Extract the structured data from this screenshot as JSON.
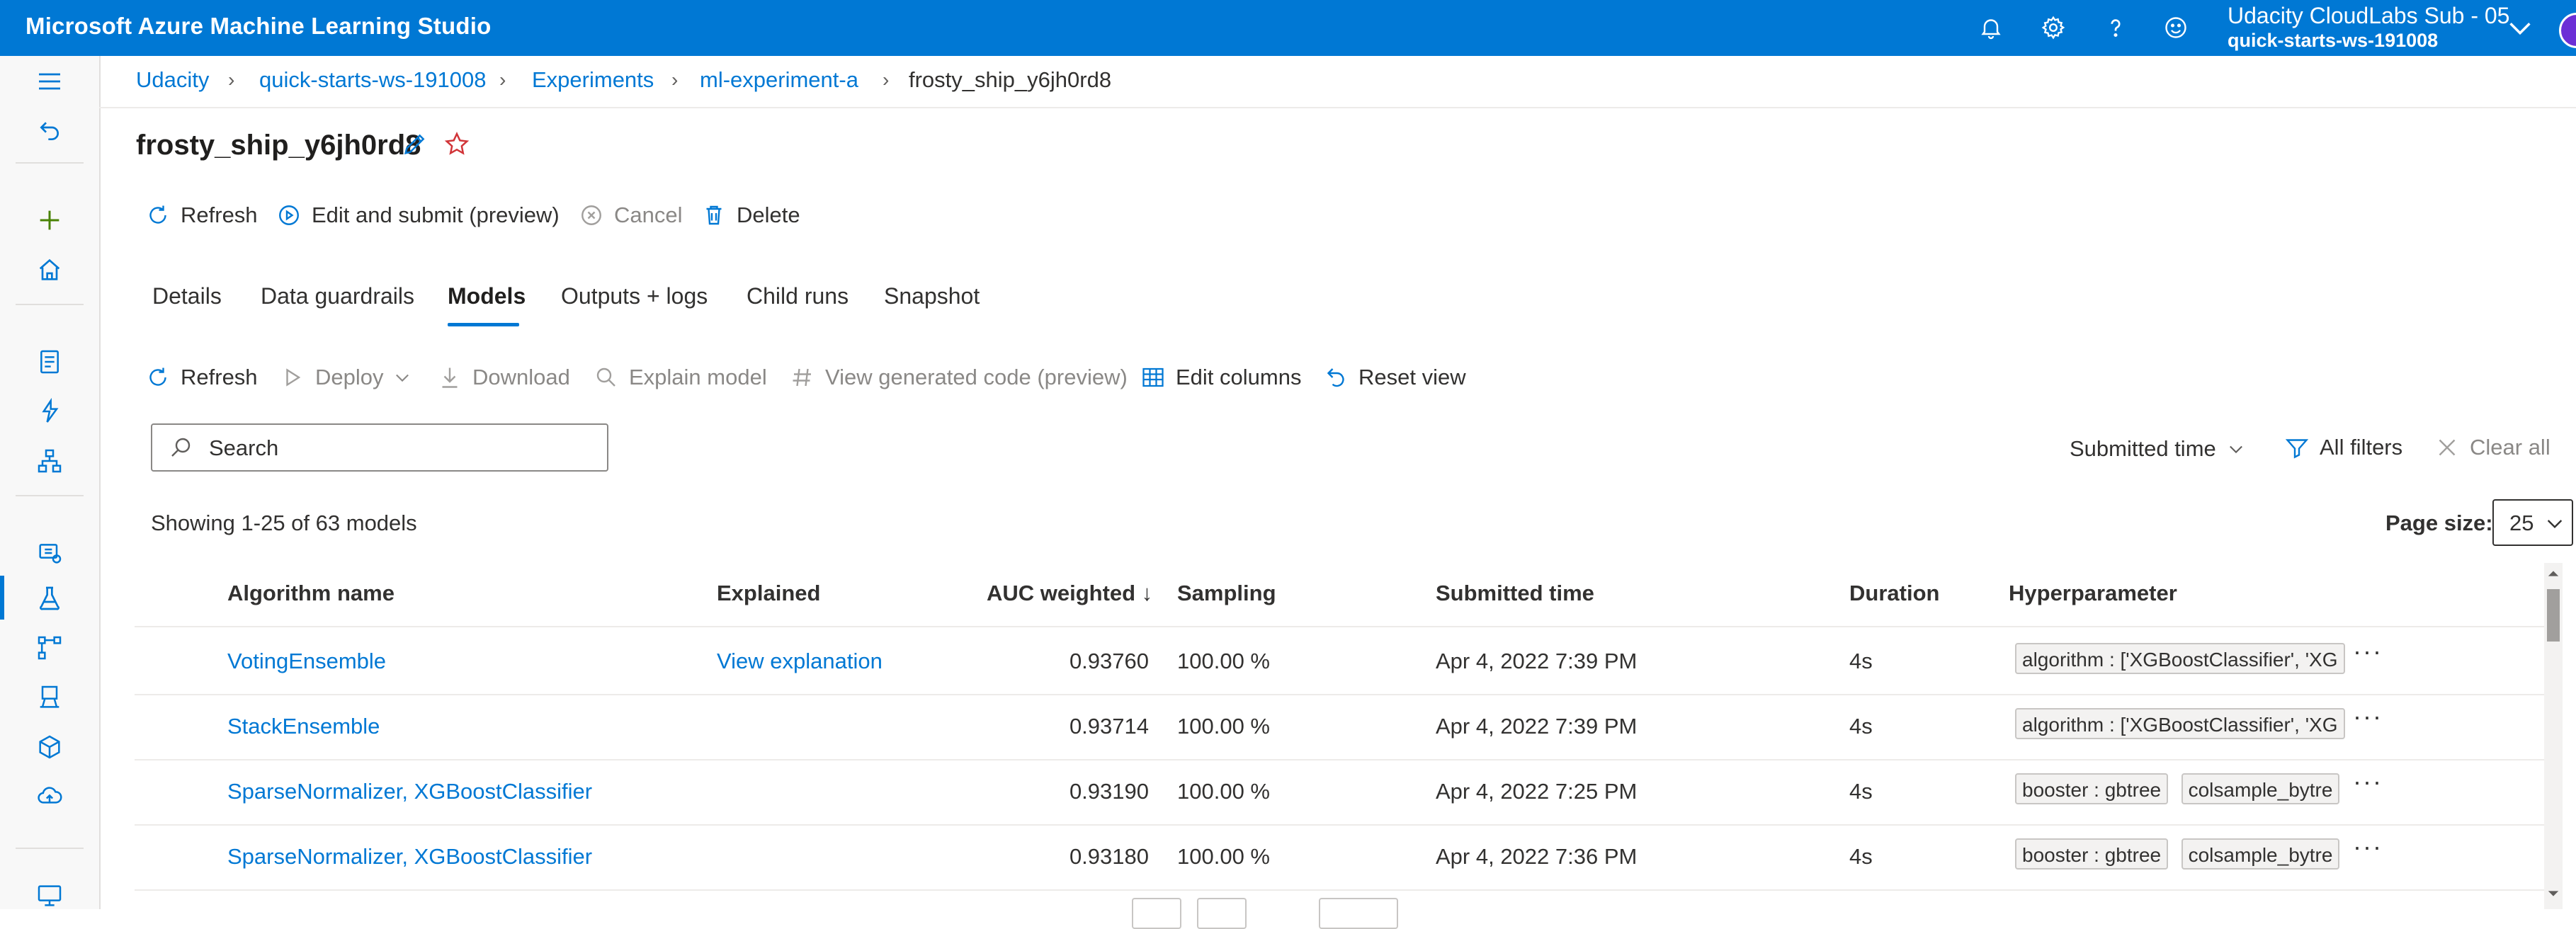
{
  "app": {
    "title": "Microsoft Azure Machine Learning Studio",
    "account_name": "Udacity CloudLabs Sub - 05",
    "account_workspace": "quick-starts-ws-191008",
    "accent": "#0078d4"
  },
  "top_icons": [
    "bell-icon",
    "gear-icon",
    "help-icon",
    "smiley-icon"
  ],
  "breadcrumb": {
    "items": [
      "Udacity",
      "quick-starts-ws-191008",
      "Experiments",
      "ml-experiment-a"
    ],
    "current": "frosty_ship_y6jh0rd8"
  },
  "run": {
    "title": "frosty_ship_y6jh0rd8"
  },
  "run_commands": {
    "refresh": "Refresh",
    "edit_submit": "Edit and submit (preview)",
    "cancel": "Cancel",
    "delete": "Delete"
  },
  "tabs": [
    "Details",
    "Data guardrails",
    "Models",
    "Outputs + logs",
    "Child runs",
    "Snapshot"
  ],
  "active_tab": "Models",
  "model_commands": {
    "refresh": "Refresh",
    "deploy": "Deploy",
    "download": "Download",
    "explain": "Explain model",
    "view_code": "View generated code (preview)",
    "edit_columns": "Edit columns",
    "reset_view": "Reset view"
  },
  "search": {
    "placeholder": "Search"
  },
  "filters": {
    "sort_by": "Submitted time",
    "all_filters": "All filters",
    "clear_all": "Clear all"
  },
  "listing": {
    "showing": "Showing 1-25 of 63 models",
    "page_size_label": "Page size:",
    "page_size": "25"
  },
  "table": {
    "columns": [
      "Algorithm name",
      "Explained",
      "AUC weighted ↓",
      "Sampling",
      "Submitted time",
      "Duration",
      "Hyperparameter"
    ],
    "rows": [
      {
        "algorithm": "VotingEnsemble",
        "explained": "View explanation",
        "auc": "0.93760",
        "sampling": "100.00 %",
        "submitted": "Apr 4, 2022 7:39 PM",
        "duration": "4s",
        "hyperparams": [
          "algorithm : ['XGBoostClassifier', 'XG"
        ]
      },
      {
        "algorithm": "StackEnsemble",
        "explained": "",
        "auc": "0.93714",
        "sampling": "100.00 %",
        "submitted": "Apr 4, 2022 7:39 PM",
        "duration": "4s",
        "hyperparams": [
          "algorithm : ['XGBoostClassifier', 'XG"
        ]
      },
      {
        "algorithm": "SparseNormalizer, XGBoostClassifier",
        "explained": "",
        "auc": "0.93190",
        "sampling": "100.00 %",
        "submitted": "Apr 4, 2022 7:25 PM",
        "duration": "4s",
        "hyperparams": [
          "booster : gbtree",
          "colsample_bytre"
        ]
      },
      {
        "algorithm": "SparseNormalizer, XGBoostClassifier",
        "explained": "",
        "auc": "0.93180",
        "sampling": "100.00 %",
        "submitted": "Apr 4, 2022 7:36 PM",
        "duration": "4s",
        "hyperparams": [
          "booster : gbtree",
          "colsample_bytre"
        ]
      }
    ]
  }
}
